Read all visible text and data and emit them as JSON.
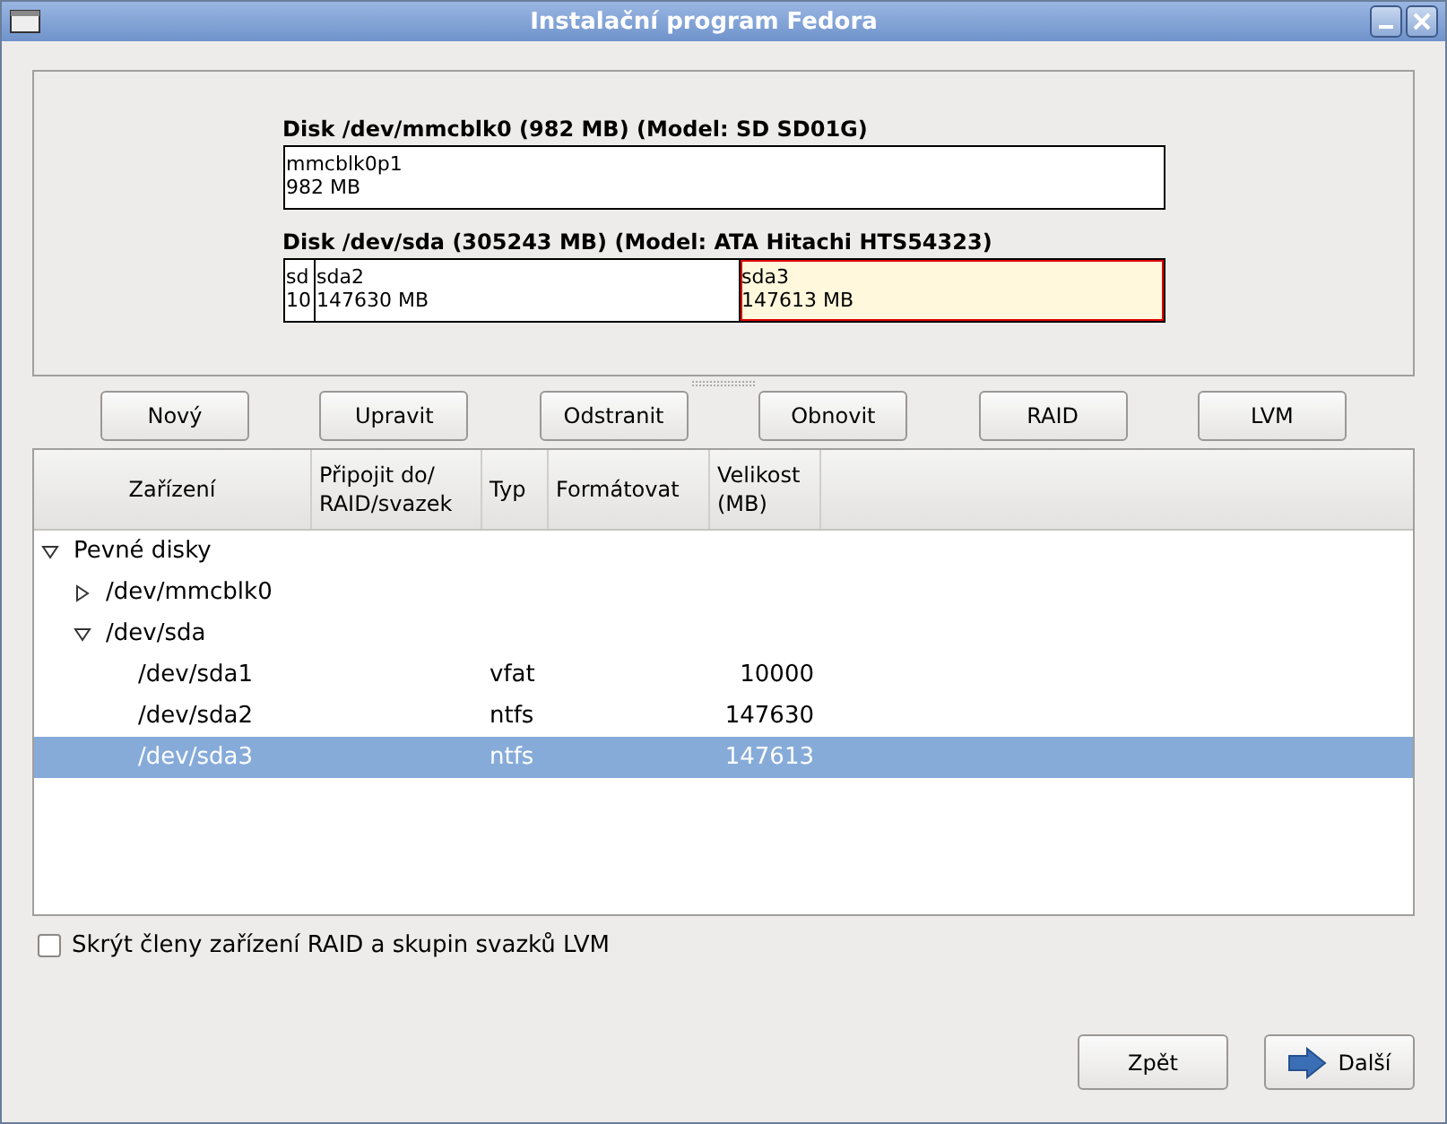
{
  "window": {
    "title": "Instalační program Fedora"
  },
  "disks": [
    {
      "title": "Disk /dev/mmcblk0 (982 MB) (Model: SD SD01G)",
      "partitions": [
        {
          "name": "mmcblk0p1",
          "size": "982 MB",
          "selected": false
        }
      ]
    },
    {
      "title": "Disk /dev/sda (305243 MB) (Model: ATA Hitachi HTS54323)",
      "partitions": [
        {
          "name": "sd",
          "size": "10",
          "selected": false
        },
        {
          "name": "sda2",
          "size": "147630 MB",
          "selected": false
        },
        {
          "name": "sda3",
          "size": "147613 MB",
          "selected": true
        }
      ]
    }
  ],
  "buttons": [
    "Nový",
    "Upravit",
    "Odstranit",
    "Obnovit",
    "RAID",
    "LVM"
  ],
  "tree": {
    "columns": [
      "Zařízení",
      "Připojit do/ RAID/svazek",
      "Typ",
      "Formátovat",
      "Velikost (MB)"
    ],
    "rows": [
      {
        "device": "Pevné disky",
        "expanded": true,
        "selected": false,
        "children": [
          {
            "device": "/dev/mmcblk0",
            "expanded": false,
            "selected": false
          },
          {
            "device": "/dev/sda",
            "expanded": true,
            "selected": false,
            "children": [
              {
                "device": "/dev/sda1",
                "type": "vfat",
                "size": "10000",
                "selected": false
              },
              {
                "device": "/dev/sda2",
                "type": "ntfs",
                "size": "147630",
                "selected": false
              },
              {
                "device": "/dev/sda3",
                "type": "ntfs",
                "size": "147613",
                "selected": true
              }
            ]
          }
        ]
      }
    ]
  },
  "hide_members": {
    "label": "Skrýt členy zařízení RAID a skupin svazků LVM",
    "checked": false
  },
  "nav": {
    "back": "Zpět",
    "next": "Další"
  }
}
